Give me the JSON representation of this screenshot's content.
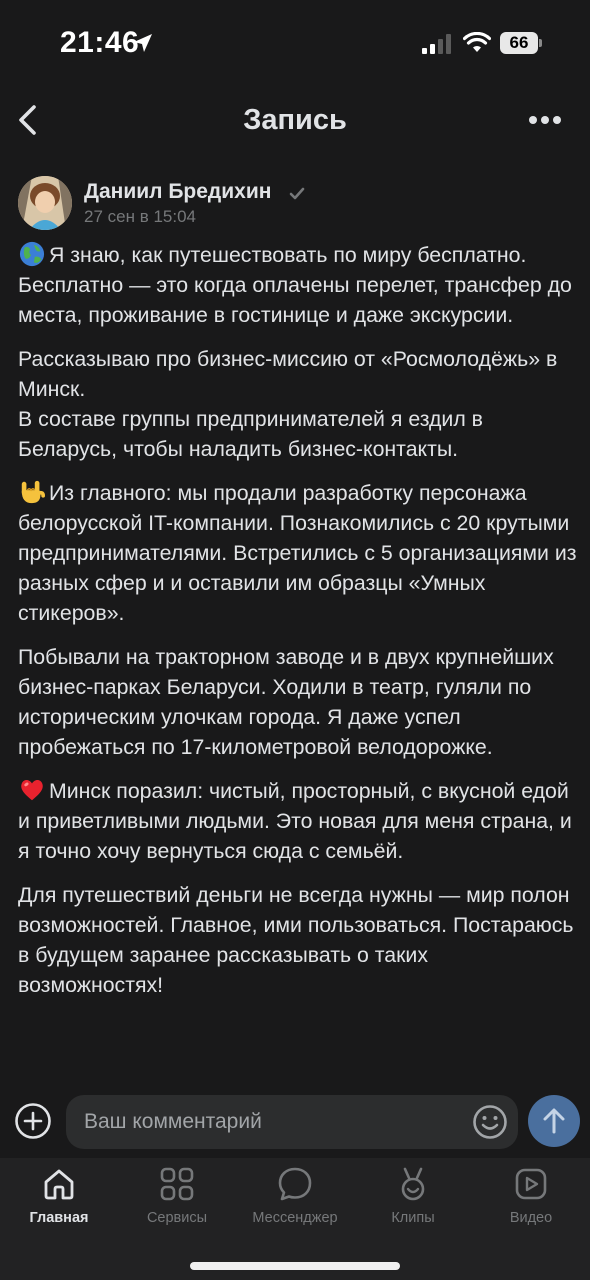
{
  "status_bar": {
    "time": "21:46",
    "battery": "66"
  },
  "header": {
    "title": "Запись"
  },
  "author": {
    "name": "Даниил Бредихин",
    "date": "27 сен в 15:04"
  },
  "post": {
    "paragraphs": [
      {
        "emoji": "globe-emoji",
        "text": "Я знаю, как путешествовать по миру бесплатно. Бесплатно — это когда оплачены перелет, трансфер до места, проживание в гостинице и даже экскурсии."
      },
      {
        "emoji": null,
        "text": "Рассказываю про бизнес-миссию от «Росмолодёжь» в Минск.\nВ составе группы предпринимателей я ездил в Беларусь, чтобы наладить бизнес-контакты."
      },
      {
        "emoji": "rock-hand-emoji",
        "text": "Из главного: мы продали разработку персонажа белорусской IT-компании. Познакомились с 20 крутыми предпринимателями. Встретились с 5 организациями из разных сфер и и оставили им образцы «Умных стикеров»."
      },
      {
        "emoji": null,
        "text": "Побывали на тракторном заводе и в двух крупнейших бизнес-парках Беларуси. Ходили в театр, гуляли по историческим улочкам города. Я даже успел пробежаться по 17-километровой велодорожке."
      },
      {
        "emoji": "heart-emoji",
        "text": "Минск поразил: чистый, просторный, с вкусной едой и приветливыми людьми. Это новая для меня страна, и я точно хочу вернуться сюда с семьёй."
      },
      {
        "emoji": null,
        "text": "Для путешествий деньги не всегда нужны — мир полон возможностей. Главное, ими пользоваться. Постараюсь в будущем заранее рассказывать о таких возможностях!"
      }
    ]
  },
  "comment": {
    "placeholder": "Ваш комментарий"
  },
  "nav": {
    "items": [
      {
        "label": "Главная",
        "icon": "home-icon"
      },
      {
        "label": "Сервисы",
        "icon": "services-icon"
      },
      {
        "label": "Мессенджер",
        "icon": "messenger-icon"
      },
      {
        "label": "Клипы",
        "icon": "clips-icon"
      },
      {
        "label": "Видео",
        "icon": "video-icon"
      }
    ]
  },
  "colors": {
    "background": "#19191a",
    "text": "#e1e3e6",
    "muted": "#76787a",
    "accent": "#4a6f9e"
  }
}
